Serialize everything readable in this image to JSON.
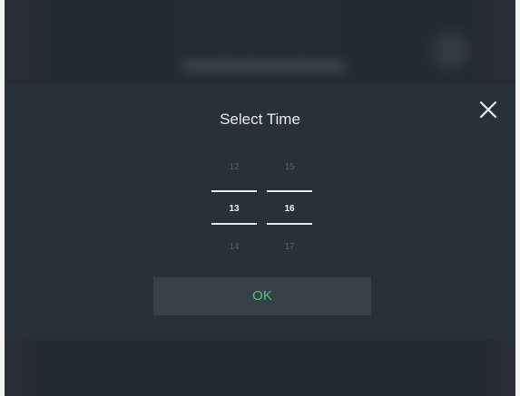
{
  "dialog": {
    "title": "Select Time",
    "close_icon": "close-icon",
    "ok_label": "OK",
    "accent_color": "#4fc07a"
  },
  "picker": {
    "hours": {
      "prev": "12",
      "selected": "13",
      "next": "14"
    },
    "minutes": {
      "prev": "15",
      "selected": "16",
      "next": "17"
    }
  }
}
